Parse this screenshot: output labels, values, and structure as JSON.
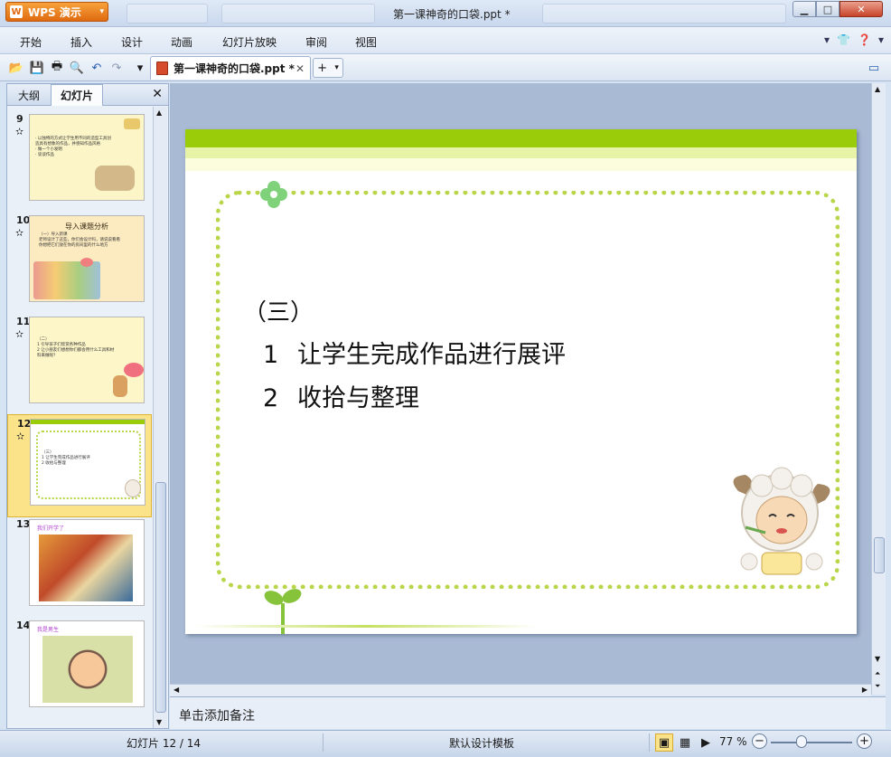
{
  "app": {
    "name": "WPS 演示"
  },
  "window": {
    "title": "第一课神奇的口袋.ppt *"
  },
  "menu": [
    "开始",
    "插入",
    "设计",
    "动画",
    "幻灯片放映",
    "审阅",
    "视图"
  ],
  "document_tab": {
    "label": "第一课神奇的口袋.ppt *"
  },
  "panel": {
    "tabs": [
      "大纲",
      "幻灯片"
    ]
  },
  "thumbnails": [
    {
      "number": "9",
      "lines": [
        "·  以独特的方式让学生用不同的造型工具创",
        "   造具有想象的作品，并感知作品风格",
        "·  做一个小发明",
        "·  谈谈作品"
      ]
    },
    {
      "number": "10",
      "title": "导入课题分析",
      "lines": [
        "（一）导入新课",
        "老师设计了这些，你们会设计吗，请说说看看",
        "你想把它们放在你的房间里的什么地方"
      ]
    },
    {
      "number": "11",
      "lines": [
        "（二）",
        "1  引导孩子们欣赏各种作品",
        "2  让小朋友们想想你们都会用什么工具和材",
        "   料来做呢？"
      ]
    },
    {
      "number": "12",
      "lines": [
        "（三）",
        "1  让学生完成作品进行展评",
        "2  收拾与整理"
      ]
    },
    {
      "number": "13",
      "title": "我们开学了"
    },
    {
      "number": "14",
      "title": "我是男生"
    }
  ],
  "slide": {
    "heading": "（三）",
    "items": [
      {
        "num": "1",
        "text": "让学生完成作品进行展评"
      },
      {
        "num": "2",
        "text": "收拾与整理"
      }
    ]
  },
  "notes": {
    "placeholder": "单击添加备注"
  },
  "status": {
    "slide_indicator": "幻灯片 12 / 14",
    "template": "默认设计模板",
    "zoom": "77 %"
  },
  "zoom": {
    "level_percent": 77
  },
  "colors": {
    "accent_green": "#9bcc0a",
    "wps_orange": "#e06a10",
    "selection_yellow": "#fbe38a"
  }
}
